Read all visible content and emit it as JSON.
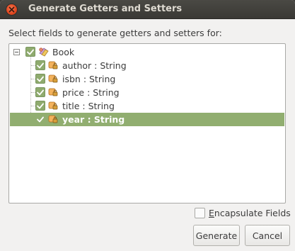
{
  "window": {
    "title": "Generate Getters and Setters"
  },
  "prompt": "Select fields to generate getters and setters for:",
  "tree": {
    "root": {
      "label": "Book",
      "checked": true,
      "expanded": true,
      "icon": "class-icon"
    },
    "fields": [
      {
        "label": "author : String",
        "checked": true,
        "selected": false,
        "icon": "private-field-icon"
      },
      {
        "label": "isbn : String",
        "checked": true,
        "selected": false,
        "icon": "private-field-icon"
      },
      {
        "label": "price : String",
        "checked": true,
        "selected": false,
        "icon": "private-field-icon"
      },
      {
        "label": "title : String",
        "checked": true,
        "selected": false,
        "icon": "private-field-icon"
      },
      {
        "label": "year : String",
        "checked": true,
        "selected": true,
        "icon": "private-field-icon"
      }
    ]
  },
  "options": {
    "encapsulate_label": "Encapsulate Fields",
    "encapsulate_checked": false
  },
  "buttons": {
    "generate": "Generate",
    "cancel": "Cancel"
  },
  "colors": {
    "selection": "#91ae70",
    "checkbox": "#8fab6e",
    "close": "#e0461f",
    "titlebar": "#3c3b37"
  }
}
